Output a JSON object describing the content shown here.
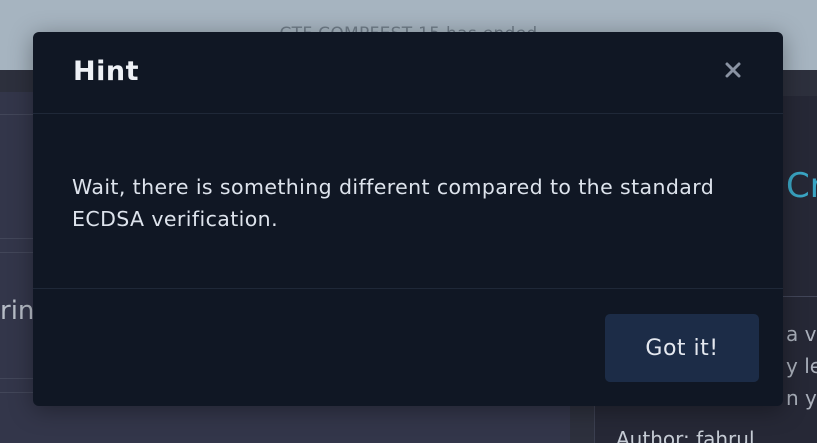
{
  "background": {
    "banner_text": "CTF COMPFEST 15 has ended",
    "left_fragment": "ring",
    "right_title_fragment": "Cr",
    "right_lines": [
      "a v",
      "y le",
      "n yo"
    ],
    "author_label": "Author: fahrul"
  },
  "modal": {
    "title": "Hint",
    "close_icon": "close-icon",
    "body_text": "Wait, there is something different compared to the standard ECDSA verification.",
    "confirm_label": "Got it!"
  },
  "colors": {
    "modal_bg": "#101724",
    "button_bg": "#1c2c47",
    "accent_cyan": "#3aa6c5"
  }
}
